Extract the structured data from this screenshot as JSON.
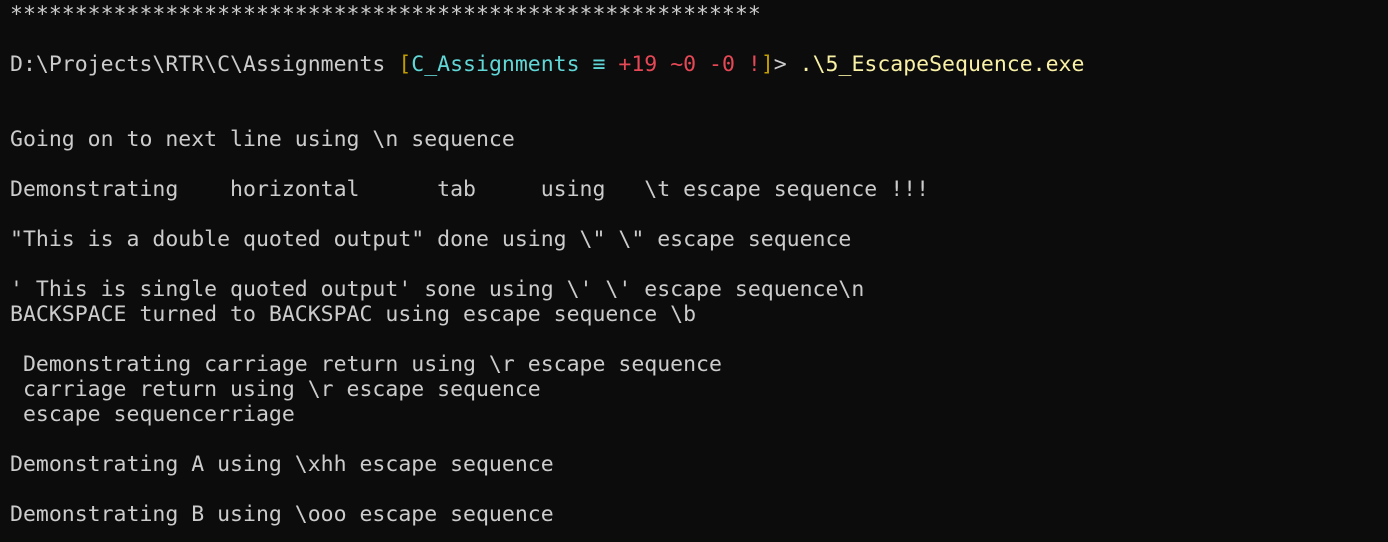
{
  "stars": "**********************************************************",
  "prompt": {
    "path": "D:\\Projects\\RTR\\C\\Assignments ",
    "bracket_open": "[",
    "branch": "C_Assignments",
    "equiv": " ≡ ",
    "ahead": "+19",
    "mod": " ~0",
    "del": " -0",
    "bang": " !",
    "bracket_close": "]",
    "arrow": "> ",
    "command": ".\\5_EscapeSequence.exe"
  },
  "output_lines": [
    "Going on to next line using \\n sequence",
    "",
    "Demonstrating    horizontal      tab     using   \\t escape sequence !!!",
    "",
    "\"This is a double quoted output\" done using \\\" \\\" escape sequence",
    "",
    "' This is single quoted output' sone using \\' \\' escape sequence\\n",
    "BACKSPACE turned to BACKSPAC using escape sequence \\b",
    "",
    " Demonstrating carriage return using \\r escape sequence",
    " carriage return using \\r escape sequence",
    " escape sequencerriage",
    "",
    "Demonstrating A using \\xhh escape sequence",
    "",
    "Demonstrating B using \\ooo escape sequence"
  ]
}
